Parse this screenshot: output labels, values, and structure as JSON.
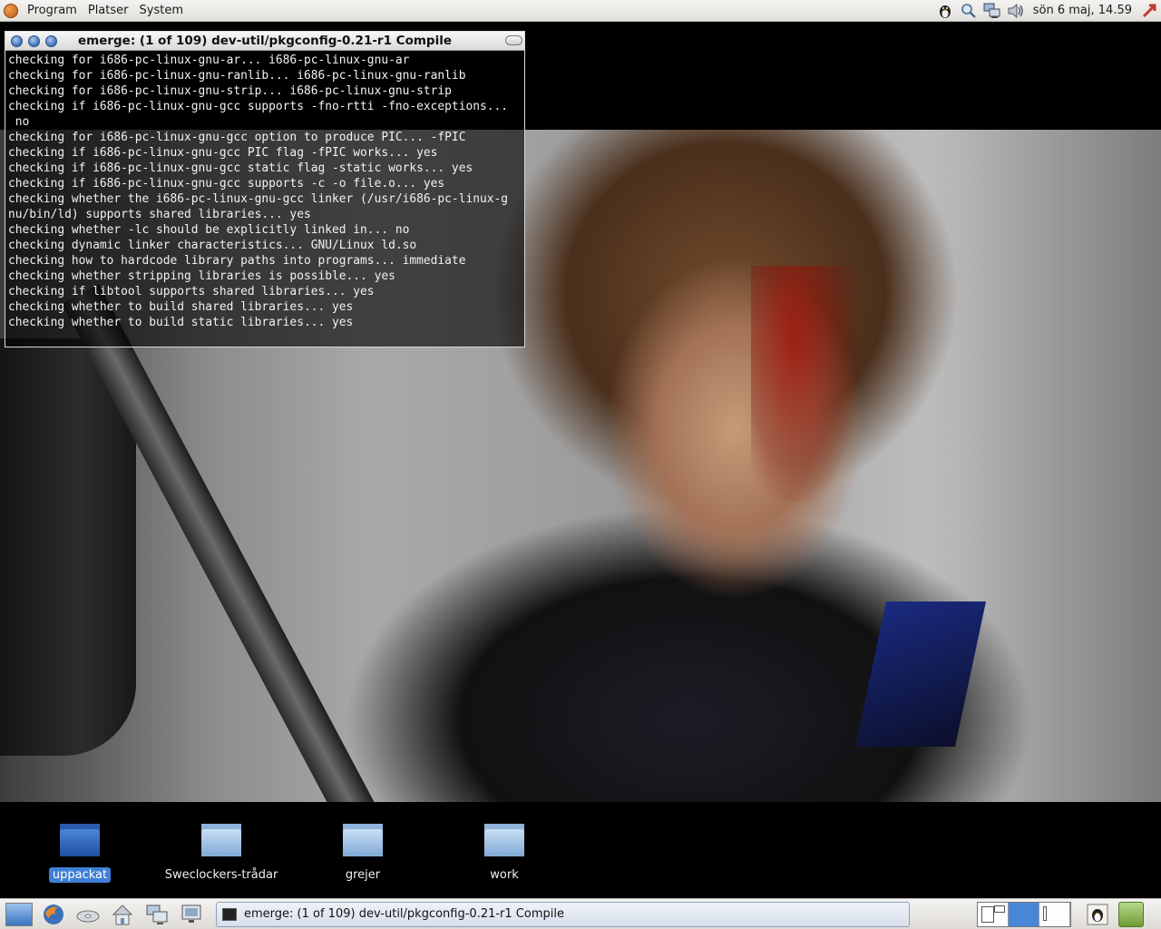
{
  "top_panel": {
    "menus": [
      "Program",
      "Platser",
      "System"
    ],
    "tray_icons": [
      "penguin-icon",
      "search-icon",
      "network-icon",
      "volume-icon"
    ],
    "clock": "sön  6 maj, 14.59",
    "end_icon": "logout-icon"
  },
  "terminal": {
    "title": "emerge: (1 of 109) dev-util/pkgconfig-0.21-r1 Compile",
    "lines": [
      "checking for i686-pc-linux-gnu-ar... i686-pc-linux-gnu-ar",
      "checking for i686-pc-linux-gnu-ranlib... i686-pc-linux-gnu-ranlib",
      "checking for i686-pc-linux-gnu-strip... i686-pc-linux-gnu-strip",
      "checking if i686-pc-linux-gnu-gcc supports -fno-rtti -fno-exceptions...",
      " no",
      "checking for i686-pc-linux-gnu-gcc option to produce PIC... -fPIC",
      "checking if i686-pc-linux-gnu-gcc PIC flag -fPIC works... yes",
      "checking if i686-pc-linux-gnu-gcc static flag -static works... yes",
      "checking if i686-pc-linux-gnu-gcc supports -c -o file.o... yes",
      "checking whether the i686-pc-linux-gnu-gcc linker (/usr/i686-pc-linux-g",
      "nu/bin/ld) supports shared libraries... yes",
      "checking whether -lc should be explicitly linked in... no",
      "checking dynamic linker characteristics... GNU/Linux ld.so",
      "checking how to hardcode library paths into programs... immediate",
      "checking whether stripping libraries is possible... yes",
      "checking if libtool supports shared libraries... yes",
      "checking whether to build shared libraries... yes",
      "checking whether to build static libraries... yes"
    ]
  },
  "desktop_icons": [
    {
      "label": "uppackat",
      "style": "dark",
      "selected": true
    },
    {
      "label": "Sweclockers-trådar",
      "style": "light",
      "selected": false
    },
    {
      "label": "grejer",
      "style": "light",
      "selected": false
    },
    {
      "label": "work",
      "style": "light",
      "selected": false
    }
  ],
  "bottom_panel": {
    "launchers": [
      "show-desktop-icon",
      "firefox-icon",
      "disc-icon",
      "home-icon",
      "computer-icon",
      "monitor-icon"
    ],
    "task_title": "emerge: (1 of 109) dev-util/pkgconfig-0.21-r1 Compile"
  }
}
